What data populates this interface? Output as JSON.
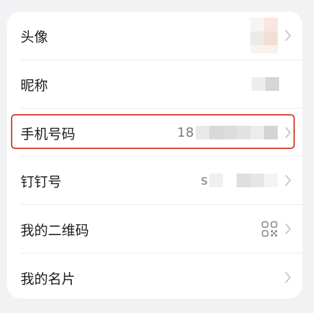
{
  "profile_items": [
    {
      "label": "头像"
    },
    {
      "label": "昵称"
    },
    {
      "label": "手机号码",
      "value_prefix": "18"
    },
    {
      "label": "钉钉号",
      "value_prefix": "s"
    },
    {
      "label": "我的二维码"
    },
    {
      "label": "我的名片"
    }
  ],
  "colors": {
    "highlight": "#d64532",
    "background": "#f2f2f5",
    "card": "#ffffff",
    "text": "#1c1c1e",
    "secondary": "#7a7a7f"
  }
}
